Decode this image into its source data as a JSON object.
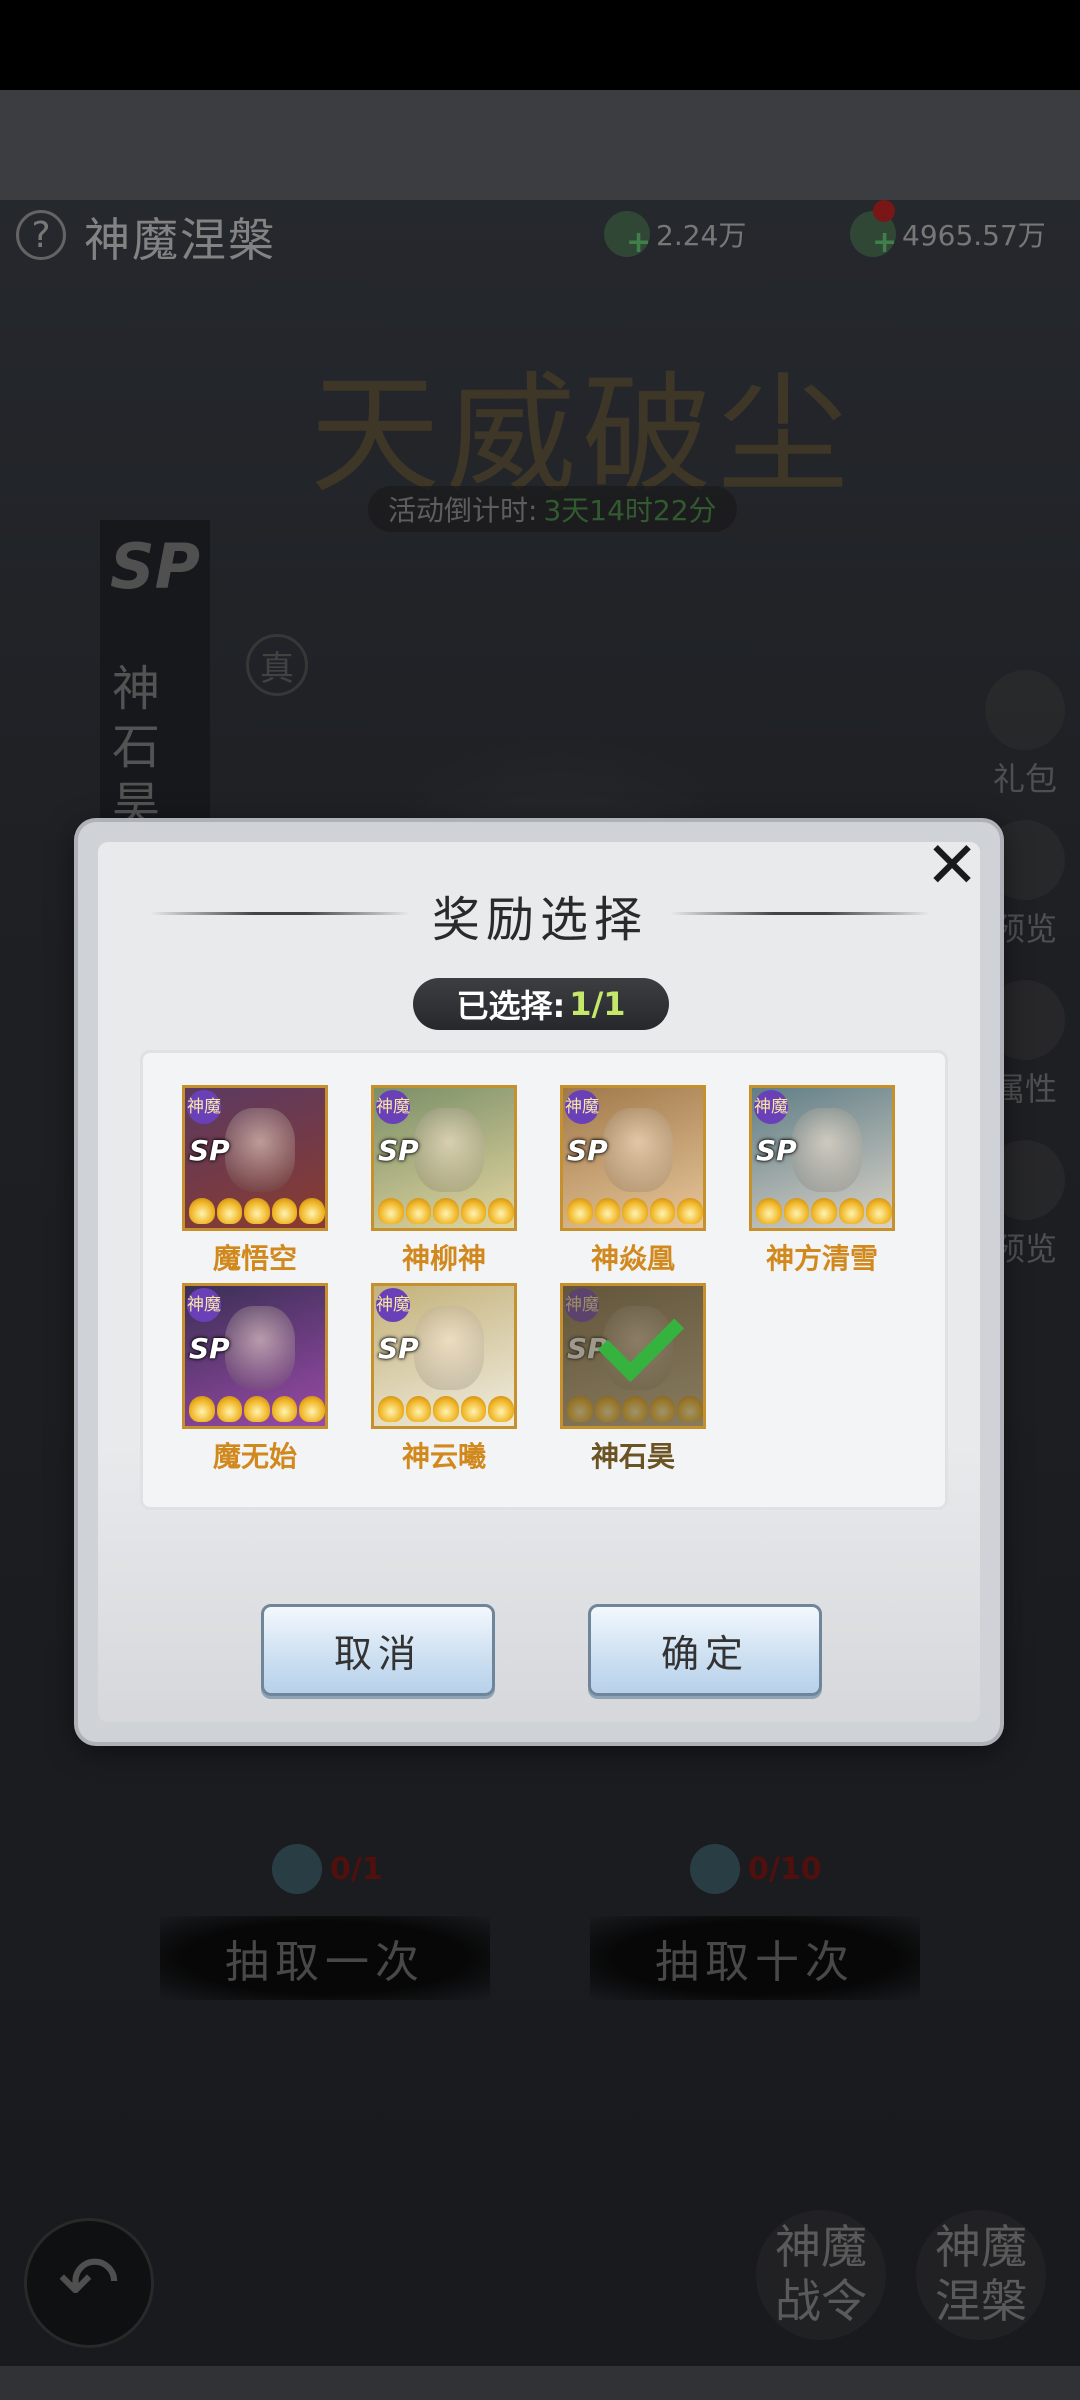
{
  "header": {
    "help_icon": "question-mark-icon",
    "title": "神魔涅槃",
    "currency1": {
      "value": "2.24万",
      "icon": "jade-coin-icon"
    },
    "currency2": {
      "value": "4965.57万",
      "icon": "jade-coin-icon"
    }
  },
  "event": {
    "title": "天威破尘",
    "countdown_label": "活动倒计时:",
    "countdown_value": "3天14时22分"
  },
  "sp_panel": {
    "badge": "SP",
    "name": "神石昊",
    "true_mark": "真"
  },
  "side_buttons": [
    {
      "label": "礼包"
    },
    {
      "label": "预览"
    },
    {
      "label": "属性"
    },
    {
      "label": "预览"
    }
  ],
  "dialog": {
    "title": "奖励选择",
    "selected_label": "已选择:",
    "selected_value": "1/1",
    "close_icon": "close-x-icon",
    "heroes": [
      {
        "name": "魔悟空",
        "tag": "神魔",
        "badge": "SP",
        "colors": [
          "#5b3a62",
          "#8a3b2e"
        ],
        "selected": false
      },
      {
        "name": "神柳神",
        "tag": "神魔",
        "badge": "SP",
        "colors": [
          "#7b8f68",
          "#e3d6a0"
        ],
        "selected": false
      },
      {
        "name": "神焱凰",
        "tag": "神魔",
        "badge": "SP",
        "colors": [
          "#a0794a",
          "#e8c79a"
        ],
        "selected": false
      },
      {
        "name": "神方清雪",
        "tag": "神魔",
        "badge": "SP",
        "colors": [
          "#607e86",
          "#d9d2c8"
        ],
        "selected": false
      },
      {
        "name": "魔无始",
        "tag": "神魔",
        "badge": "SP",
        "colors": [
          "#3a2f55",
          "#9a4aa8"
        ],
        "selected": false
      },
      {
        "name": "神云曦",
        "tag": "神魔",
        "badge": "SP",
        "colors": [
          "#c4b27a",
          "#f0ecdf"
        ],
        "selected": false
      },
      {
        "name": "神石昊",
        "tag": "神魔",
        "badge": "SP",
        "colors": [
          "#7a6a48",
          "#cbbd96"
        ],
        "selected": true
      }
    ],
    "cancel_label": "取消",
    "confirm_label": "确定"
  },
  "draw": {
    "single": {
      "cost": "0/1",
      "label": "抽取一次"
    },
    "ten": {
      "cost": "0/10",
      "label": "抽取十次"
    }
  },
  "bottom": {
    "back_icon": "back-arrow-icon",
    "battle_pass_label": "神魔战令",
    "nirvana_label": "神魔涅槃"
  }
}
